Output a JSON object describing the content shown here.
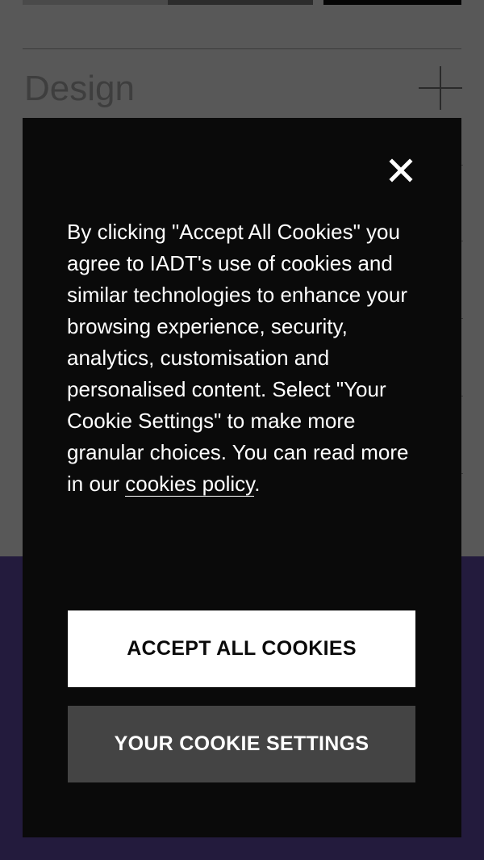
{
  "background": {
    "accordion_title": "Design"
  },
  "cookie_modal": {
    "message": "By clicking \"Accept All Cookies\" you agree to IADT's use of cookies and similar technologies to enhance your browsing experience, security, analytics, customisation and personalised content. Select \"Your Cookie Settings\" to make more granular choices. You can read more in our ",
    "link_text": "cookies policy",
    "message_end": ".",
    "accept_label": "ACCEPT ALL COOKIES",
    "settings_label": "YOUR COOKIE SETTINGS",
    "close_icon": "close-icon"
  },
  "colors": {
    "overlay_gray": "#585858",
    "modal_bg": "#0a0a0a",
    "accept_bg": "#ffffff",
    "settings_bg": "#444444",
    "footer_purple": "#231b3d"
  }
}
